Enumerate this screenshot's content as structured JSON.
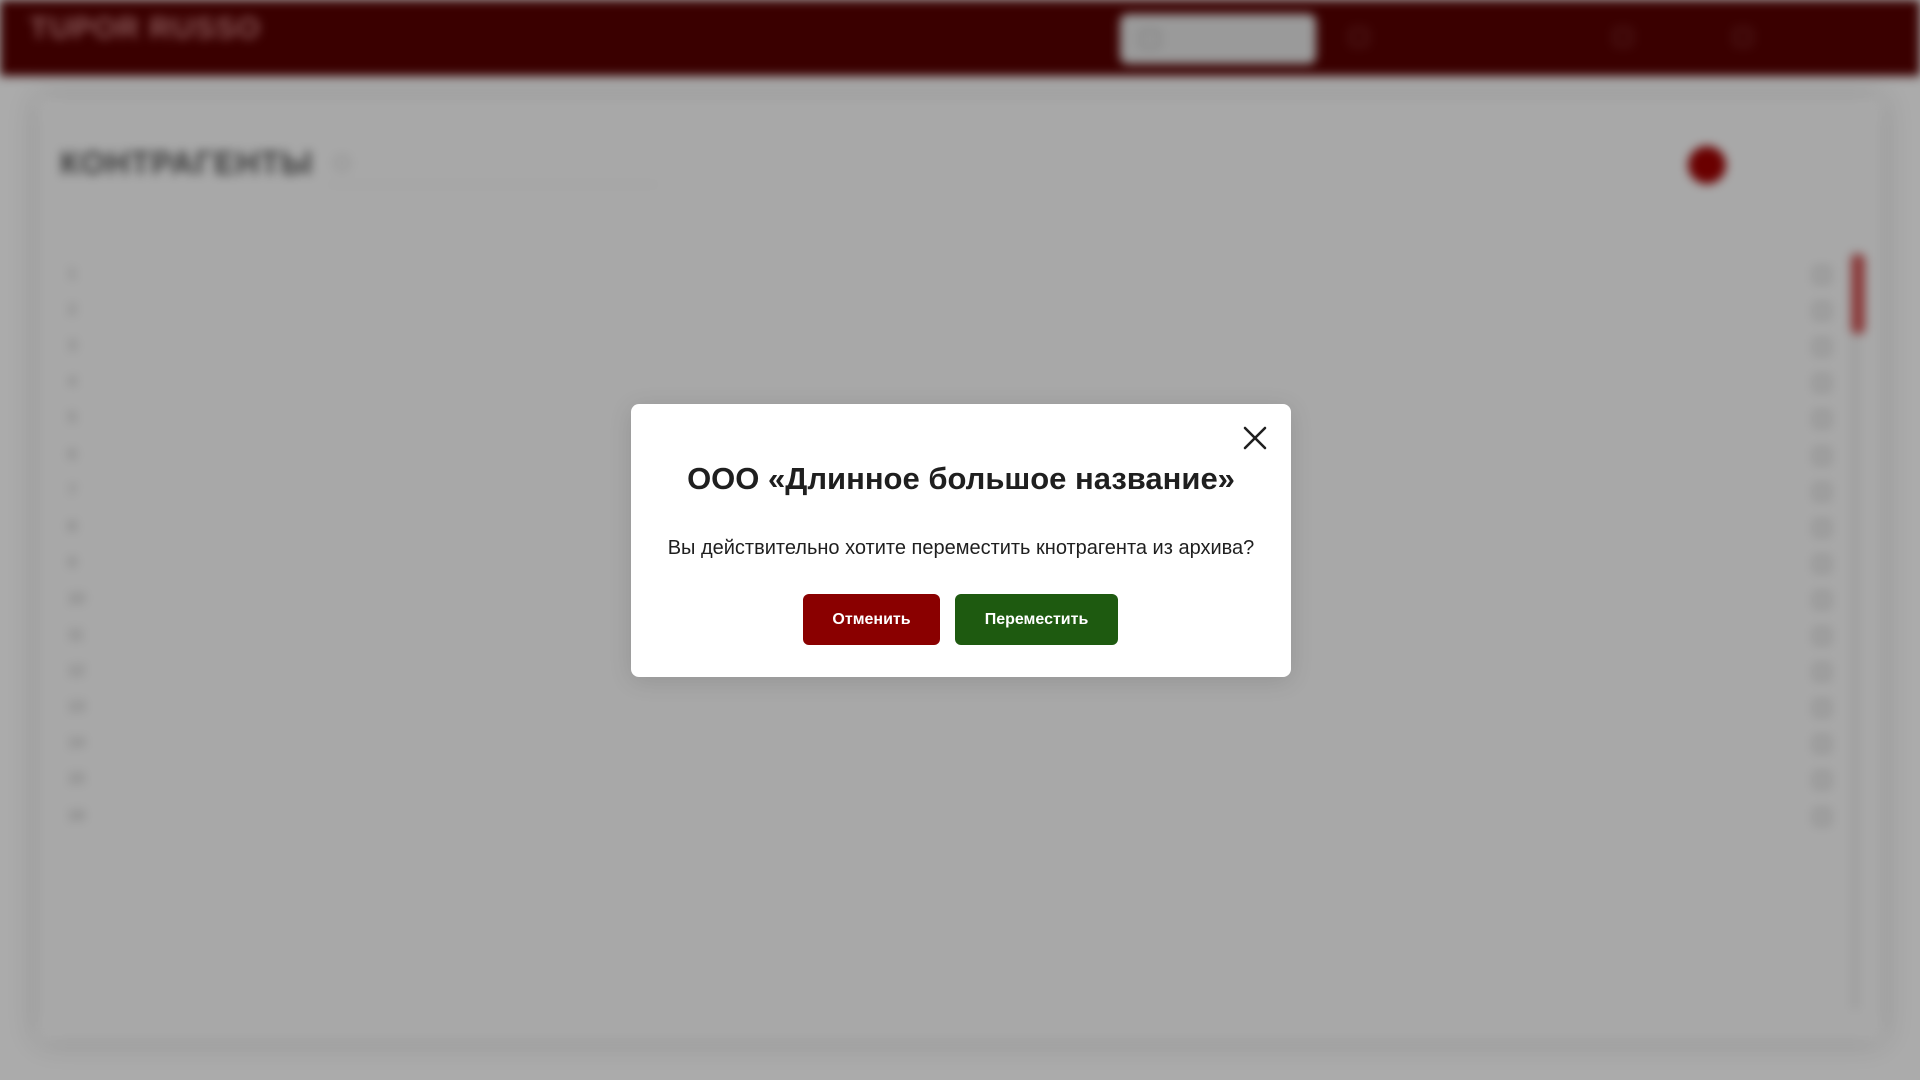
{
  "background": {
    "logo": {
      "name": "TUPOR RUSSO",
      "tagline": ""
    },
    "header": {
      "archive_button": "",
      "nav": [
        "",
        "",
        ""
      ]
    },
    "page_title": "КОНТРАГЕНТЫ",
    "search_placeholder": "",
    "toggle_label": "",
    "table": {
      "headers": [
        "",
        "",
        "",
        "",
        "",
        ""
      ],
      "row_numbers": [
        "1",
        "2",
        "3",
        "4",
        "5",
        "6",
        "7",
        "8",
        "9",
        "10",
        "11",
        "12",
        "13",
        "14",
        "15",
        "16"
      ]
    }
  },
  "modal": {
    "title": "ООО «Длинное большое название»",
    "message": "Вы действительно хотите переместить кнотрагента из архива?",
    "cancel_label": "Отменить",
    "confirm_label": "Переместить"
  },
  "colors": {
    "header": "#3a0000",
    "cancel": "#8a0000",
    "confirm": "#1e5a10"
  }
}
